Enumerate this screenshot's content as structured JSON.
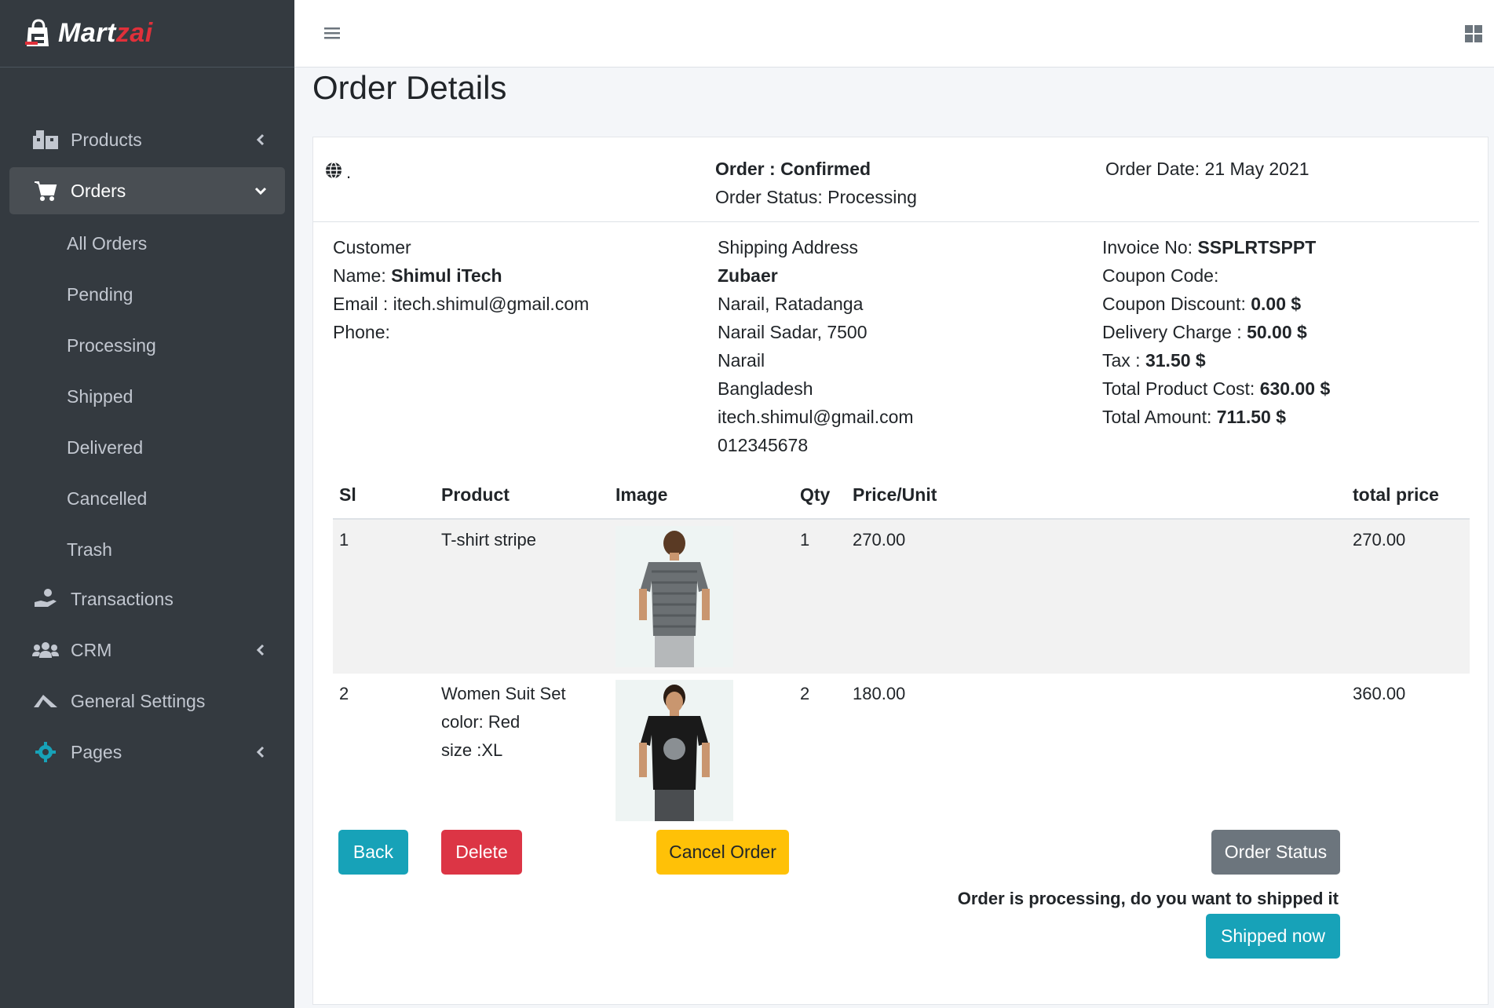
{
  "brand": {
    "name_part1": "Mart",
    "name_part2": "zai",
    "accent": "#e0303a"
  },
  "sidebar": {
    "items": [
      {
        "label": "Products",
        "icon": "boxes-icon"
      },
      {
        "label": "Orders",
        "icon": "cart-icon",
        "active": true
      },
      {
        "label": "Transactions",
        "icon": "hand-coin-icon"
      },
      {
        "label": "CRM",
        "icon": "users-icon"
      },
      {
        "label": "General Settings",
        "icon": "settings-gear-icon"
      },
      {
        "label": "Pages",
        "icon": "cog-icon"
      }
    ],
    "order_subitems": [
      "All Orders",
      "Pending",
      "Processing",
      "Shipped",
      "Delivered",
      "Cancelled",
      "Trash"
    ]
  },
  "page": {
    "title": "Order Details"
  },
  "order": {
    "dot": ".",
    "status_label": "Order : Confirmed",
    "order_status": "Order Status: Processing",
    "order_date": "Order Date: 21 May 2021"
  },
  "customer": {
    "heading": "Customer",
    "name_label": "Name: ",
    "name": "Shimul iTech",
    "email": "Email : itech.shimul@gmail.com",
    "phone": "Phone:"
  },
  "shipping": {
    "heading": "Shipping Address",
    "name": "Zubaer",
    "lines": [
      "Narail, Ratadanga",
      "Narail Sadar, 7500",
      "Narail",
      "Bangladesh",
      "itech.shimul@gmail.com",
      "012345678"
    ]
  },
  "invoice": {
    "invoice_label": "Invoice No: ",
    "invoice_no": "SSPLRTSPPT",
    "coupon_code": "Coupon Code:",
    "coupon_discount_label": "Coupon Discount: ",
    "coupon_discount": "0.00 $",
    "delivery_label": "Delivery Charge : ",
    "delivery": "50.00 $",
    "tax_label": "Tax : ",
    "tax": "31.50 $",
    "product_cost_label": "Total Product Cost: ",
    "product_cost": "630.00 $",
    "total_label": "Total Amount: ",
    "total": "711.50 $"
  },
  "table": {
    "headers": [
      "Sl",
      "Product",
      "Image",
      "Qty",
      "Price/Unit",
      "total price"
    ],
    "rows": [
      {
        "sl": "1",
        "product": "T-shirt stripe",
        "color": "",
        "size": "",
        "qty": "1",
        "price": "270.00",
        "total": "270.00",
        "image": "grey-striped-tshirt-photo"
      },
      {
        "sl": "2",
        "product": "Women Suit Set",
        "color": "color: Red",
        "size": "size :XL",
        "qty": "2",
        "price": "180.00",
        "total": "360.00",
        "image": "black-tshirt-photo"
      }
    ]
  },
  "buttons": {
    "back": "Back",
    "delete": "Delete",
    "cancel_order": "Cancel Order",
    "order_status": "Order Status",
    "shipped_now": "Shipped now"
  },
  "prompt": "Order is processing, do you want to shipped it"
}
